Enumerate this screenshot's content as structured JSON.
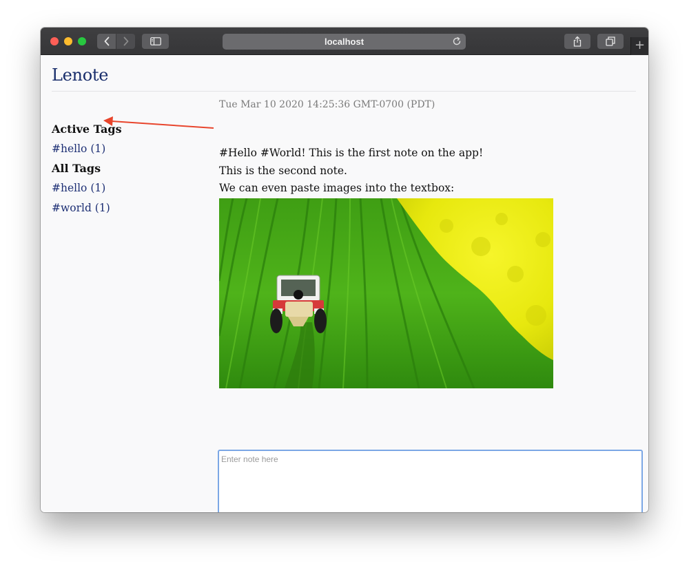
{
  "browser": {
    "url": "localhost",
    "new_tab_label": "+"
  },
  "app": {
    "title": "Lenote"
  },
  "sidebar": {
    "active_tags_heading": "Active Tags",
    "active_tags": [
      {
        "label": "#hello (1)"
      }
    ],
    "all_tags_heading": "All Tags",
    "all_tags": [
      {
        "label": "#hello (1)"
      },
      {
        "label": "#world (1)"
      }
    ]
  },
  "note": {
    "timestamp": "Tue Mar 10 2020 14:25:36 GMT-0700 (PDT)",
    "lines": [
      "#Hello #World! This is the first note on the app!",
      "This is the second note.",
      "We can even paste images into the textbox:"
    ]
  },
  "input": {
    "placeholder": "Enter note here",
    "value": ""
  },
  "colors": {
    "accent": "#182d6b",
    "link": "#1d2f74",
    "focus_ring": "#7ba7e5",
    "annotation_arrow": "#e8452c"
  },
  "icons": {
    "back": "chevron-left-icon",
    "forward": "chevron-right-icon",
    "sidebar": "sidebar-icon",
    "reload": "reload-icon",
    "share": "share-icon",
    "tabs": "tabs-icon"
  }
}
